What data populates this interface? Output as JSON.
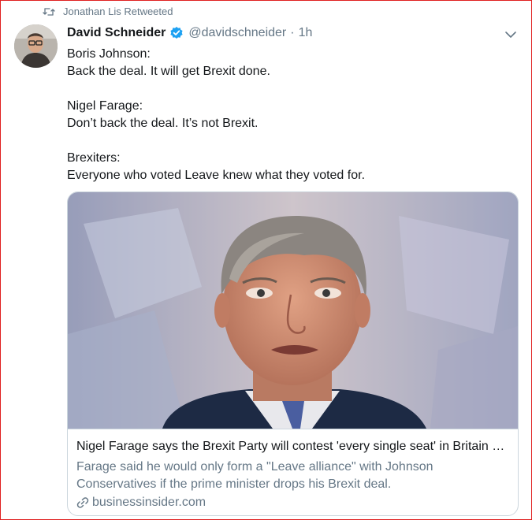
{
  "context": {
    "retweeted_by": "Jonathan Lis Retweeted"
  },
  "author": {
    "name": "David Schneider",
    "handle": "@davidschneider",
    "separator": "·",
    "time": "1h",
    "verified": true
  },
  "tweet": {
    "lines": [
      "Boris Johnson:",
      "Back the deal. It will get Brexit done.",
      "",
      "Nigel Farage:",
      "Don’t back the deal. It’s not Brexit.",
      "",
      "Brexiters:",
      "Everyone who voted Leave knew what they voted for."
    ]
  },
  "card": {
    "title": "Nigel Farage says the Brexit Party will contest 'every single seat' in Britain unless Johnson drops his deal",
    "description": "Farage said he would only form a \"Leave alliance\" with Johnson Conservatives if the prime minister drops his Brexit deal.",
    "domain": "businessinsider.com"
  },
  "colors": {
    "text_primary": "#14171a",
    "text_secondary": "#657786",
    "verified_blue": "#1da1f2",
    "border": "#ccd6dd",
    "frame_red": "#e02020"
  },
  "icons": {
    "retweet": "retweet-icon",
    "verified": "verified-badge-icon",
    "caret": "chevron-down-icon",
    "link": "link-icon"
  }
}
